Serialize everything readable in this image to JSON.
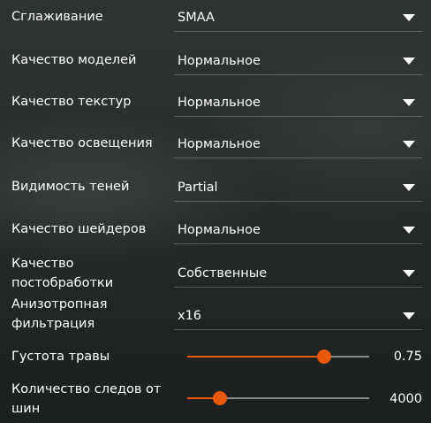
{
  "settings": {
    "antialiasing": {
      "label": "Сглаживание",
      "value": "SMAA"
    },
    "model_quality": {
      "label": "Качество моделей",
      "value": "Нормальное"
    },
    "texture_quality": {
      "label": "Качество текстур",
      "value": "Нормальное"
    },
    "lighting_quality": {
      "label": "Качество освещения",
      "value": "Нормальное"
    },
    "shadow_visibility": {
      "label": "Видимость теней",
      "value": "Partial"
    },
    "shader_quality": {
      "label": "Качество шейдеров",
      "value": "Нормальное"
    },
    "postprocess_quality": {
      "label": "Качество постобработки",
      "value": "Собственные"
    },
    "anisotropic_filtering": {
      "label": "Анизотропная фильтрация",
      "value": "x16"
    },
    "grass_density": {
      "label": "Густота травы",
      "value": "0.75",
      "fill_fraction": 0.75
    },
    "tire_tracks": {
      "label": "Количество следов от шин",
      "value": "4000",
      "fill_fraction": 0.18
    }
  },
  "colors": {
    "accent": "#e8590c",
    "track": "#8a8d8c",
    "text": "#ffffff"
  },
  "icons": {
    "dropdown": "chevron-down-icon"
  }
}
